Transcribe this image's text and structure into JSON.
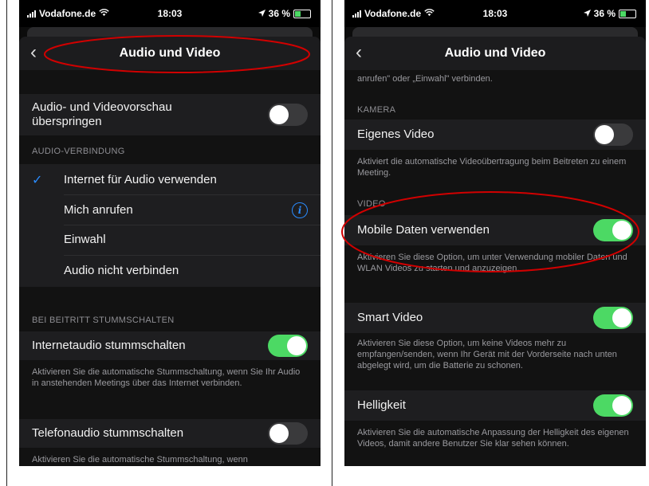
{
  "status_bar": {
    "carrier": "Vodafone.de",
    "time": "18:03",
    "battery": "36 %"
  },
  "left_screen": {
    "nav_title": "Audio und Video",
    "skip_preview_label": "Audio- und Videovorschau\nüberspringen",
    "audio_connection_header": "AUDIO-VERBINDUNG",
    "audio_options": [
      "Internet für Audio verwenden",
      "Mich anrufen",
      "Einwahl",
      "Audio nicht verbinden"
    ],
    "selected_option": "Internet für Audio verwenden",
    "mute_on_join_header": "BEI BEITRITT STUMMSCHALTEN",
    "internet_audio_label": "Internetaudio stummschalten",
    "internet_audio_desc": "Aktivieren Sie die automatische Stummschaltung, wenn Sie Ihr Audio in anstehenden Meetings über das Internet verbinden.",
    "phone_audio_label": "Telefonaudio stummschalten",
    "phone_audio_desc": "Aktivieren Sie die automatische Stummschaltung, wenn"
  },
  "right_screen": {
    "nav_title": "Audio und Video",
    "top_cut_text": "anrufen\" oder „Einwahl\" verbinden.",
    "camera_header": "KAMERA",
    "own_video_label": "Eigenes Video",
    "own_video_desc": "Aktiviert die automatische Videoübertragung beim Beitreten zu einem Meeting.",
    "video_header": "VIDEO",
    "mobile_data_label": "Mobile Daten verwenden",
    "mobile_data_desc": "Aktivieren Sie diese Option, um unter Verwendung mobiler Daten und WLAN Videos zu starten und anzuzeigen.",
    "smart_video_label": "Smart Video",
    "smart_video_desc": "Aktivieren Sie diese Option, um keine Videos mehr zu empfangen/senden, wenn Ihr Gerät mit der Vorderseite nach unten abgelegt wird, um die Batterie zu schonen.",
    "brightness_label": "Helligkeit",
    "brightness_desc": "Aktivieren Sie die automatische Anpassung der Helligkeit des eigenen Videos, damit andere Benutzer Sie klar sehen können."
  },
  "toggles": {
    "skip_preview": false,
    "internet_audio": true,
    "phone_audio": false,
    "own_video": false,
    "mobile_data": true,
    "smart_video": true,
    "brightness": true
  },
  "colors": {
    "toggle_on": "#4cd964",
    "accent_blue": "#2a8cff",
    "annotation_red": "#d10000"
  }
}
